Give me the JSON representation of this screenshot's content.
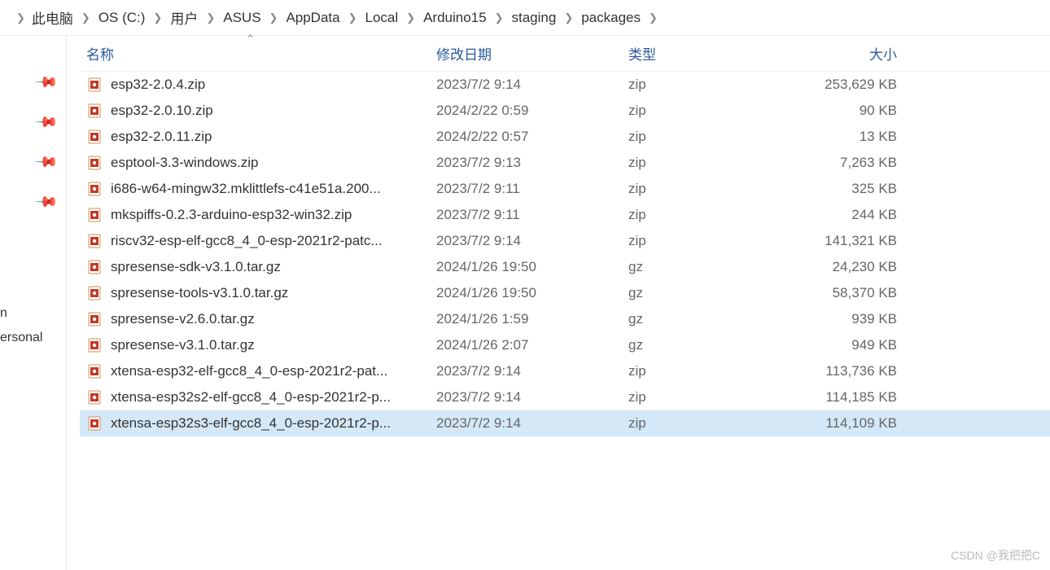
{
  "breadcrumb": [
    "此电脑",
    "OS (C:)",
    "用户",
    "ASUS",
    "AppData",
    "Local",
    "Arduino15",
    "staging",
    "packages"
  ],
  "columns": {
    "name": "名称",
    "date": "修改日期",
    "type": "类型",
    "size": "大小"
  },
  "sidebar": {
    "text1": "n",
    "text2": "ersonal"
  },
  "files": [
    {
      "name": "esp32-2.0.4.zip",
      "date": "2023/7/2 9:14",
      "type": "zip",
      "size": "253,629 KB",
      "selected": false
    },
    {
      "name": "esp32-2.0.10.zip",
      "date": "2024/2/22 0:59",
      "type": "zip",
      "size": "90 KB",
      "selected": false
    },
    {
      "name": "esp32-2.0.11.zip",
      "date": "2024/2/22 0:57",
      "type": "zip",
      "size": "13 KB",
      "selected": false
    },
    {
      "name": "esptool-3.3-windows.zip",
      "date": "2023/7/2 9:13",
      "type": "zip",
      "size": "7,263 KB",
      "selected": false
    },
    {
      "name": "i686-w64-mingw32.mklittlefs-c41e51a.200...",
      "date": "2023/7/2 9:11",
      "type": "zip",
      "size": "325 KB",
      "selected": false
    },
    {
      "name": "mkspiffs-0.2.3-arduino-esp32-win32.zip",
      "date": "2023/7/2 9:11",
      "type": "zip",
      "size": "244 KB",
      "selected": false
    },
    {
      "name": "riscv32-esp-elf-gcc8_4_0-esp-2021r2-patc...",
      "date": "2023/7/2 9:14",
      "type": "zip",
      "size": "141,321 KB",
      "selected": false
    },
    {
      "name": "spresense-sdk-v3.1.0.tar.gz",
      "date": "2024/1/26 19:50",
      "type": "gz",
      "size": "24,230 KB",
      "selected": false
    },
    {
      "name": "spresense-tools-v3.1.0.tar.gz",
      "date": "2024/1/26 19:50",
      "type": "gz",
      "size": "58,370 KB",
      "selected": false
    },
    {
      "name": "spresense-v2.6.0.tar.gz",
      "date": "2024/1/26 1:59",
      "type": "gz",
      "size": "939 KB",
      "selected": false
    },
    {
      "name": "spresense-v3.1.0.tar.gz",
      "date": "2024/1/26 2:07",
      "type": "gz",
      "size": "949 KB",
      "selected": false
    },
    {
      "name": "xtensa-esp32-elf-gcc8_4_0-esp-2021r2-pat...",
      "date": "2023/7/2 9:14",
      "type": "zip",
      "size": "113,736 KB",
      "selected": false
    },
    {
      "name": "xtensa-esp32s2-elf-gcc8_4_0-esp-2021r2-p...",
      "date": "2023/7/2 9:14",
      "type": "zip",
      "size": "114,185 KB",
      "selected": false
    },
    {
      "name": "xtensa-esp32s3-elf-gcc8_4_0-esp-2021r2-p...",
      "date": "2023/7/2 9:14",
      "type": "zip",
      "size": "114,109 KB",
      "selected": true
    }
  ],
  "watermark": "CSDN @我把把C"
}
